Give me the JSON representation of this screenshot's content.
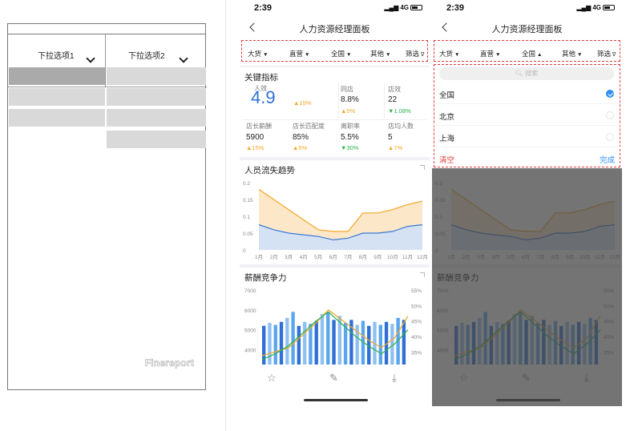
{
  "wireframe": {
    "dropdown1_label": "下拉选项1",
    "dropdown2_label": "下拉选项2",
    "watermark": "Finereport"
  },
  "phone": {
    "time": "2:39",
    "network": "4G",
    "title": "人力资源经理面板",
    "filters": [
      {
        "label": "大货",
        "arrow": "▼"
      },
      {
        "label": "直营",
        "arrow": "▼"
      },
      {
        "label": "全国",
        "arrow": "▼"
      },
      {
        "label": "其他",
        "arrow": "▼"
      },
      {
        "label": "筛选",
        "arrow": "∇"
      }
    ],
    "filters_open": [
      {
        "label": "大货",
        "arrow": "▼"
      },
      {
        "label": "直营",
        "arrow": "▼"
      },
      {
        "label": "全国",
        "arrow": "▲"
      },
      {
        "label": "其他",
        "arrow": "▼"
      },
      {
        "label": "筛选",
        "arrow": "∇"
      }
    ]
  },
  "kpi": {
    "title": "关键指标",
    "main_label": "人效",
    "main_value": "4.9",
    "main_delta": "▲15%",
    "items": [
      {
        "label": "同店",
        "value": "8.8%",
        "delta": "▲5%",
        "dir": "up"
      },
      {
        "label": "店效",
        "value": "22",
        "delta": "▼1.08%",
        "dir": "down"
      },
      {
        "label": "店长薪酬",
        "value": "5900",
        "delta": "▲15%",
        "dir": "up"
      },
      {
        "label": "店长匹配度",
        "value": "85%",
        "delta": "▲5%",
        "dir": "up"
      },
      {
        "label": "离职率",
        "value": "5.5%",
        "delta": "▼30%",
        "dir": "down"
      },
      {
        "label": "店均人数",
        "value": "5",
        "delta": "▲7%",
        "dir": "up"
      }
    ]
  },
  "turnover": {
    "title": "人员流失趋势"
  },
  "salary": {
    "title": "薪酬竞争力"
  },
  "dropdown": {
    "search_placeholder": "搜索",
    "options": [
      {
        "label": "全国",
        "selected": true
      },
      {
        "label": "北京",
        "selected": false
      },
      {
        "label": "上海",
        "selected": false
      }
    ],
    "clear_label": "清空",
    "done_label": "完成"
  },
  "chart_data": [
    {
      "type": "area",
      "title": "人员流失趋势",
      "categories": [
        "1月",
        "2月",
        "3月",
        "4月",
        "5月",
        "6月",
        "7月",
        "8月",
        "9月",
        "10月",
        "11月",
        "12月"
      ],
      "ylim": [
        0,
        0.2
      ],
      "yticks": [
        "0",
        "0.05",
        "0.1",
        "0.15",
        "0.2"
      ],
      "series": [
        {
          "values": [
            0.18,
            0.15,
            0.12,
            0.09,
            0.06,
            0.055,
            0.055,
            0.11,
            0.11,
            0.12,
            0.135,
            0.145
          ],
          "color": "#f5a623"
        },
        {
          "values": [
            0.075,
            0.06,
            0.05,
            0.045,
            0.04,
            0.03,
            0.035,
            0.05,
            0.05,
            0.055,
            0.07,
            0.075
          ],
          "color": "#3a78d8"
        }
      ],
      "grid": false
    },
    {
      "type": "bar",
      "title": "薪酬竞争力",
      "ylim": [
        3500,
        7000
      ],
      "yticks_left": [
        "4000",
        "5000",
        "6000",
        "7000"
      ],
      "yticks_right": [
        "35%",
        "40%",
        "45%",
        "50%",
        "55%"
      ],
      "y2lim": [
        0.325,
        0.55
      ],
      "bar_values": [
        5200,
        5350,
        5250,
        5400,
        5600,
        5900,
        5200,
        5400,
        5300,
        5450,
        5800,
        5900,
        5500,
        5700,
        5350,
        5500,
        5250,
        5450,
        5200,
        5400,
        5250,
        5400,
        5300,
        5600,
        5500
      ],
      "series": [
        {
          "values": [
            3700,
            3900,
            4100,
            4700,
            5300,
            6000,
            5500,
            5000,
            4500,
            4100,
            4600,
            5700
          ],
          "color": "#f5a623"
        },
        {
          "values": [
            3500,
            3800,
            4200,
            4800,
            5400,
            5900,
            5300,
            4700,
            4200,
            3800,
            4300,
            5000
          ],
          "color": "#2bb24c"
        }
      ],
      "grid": false
    }
  ]
}
